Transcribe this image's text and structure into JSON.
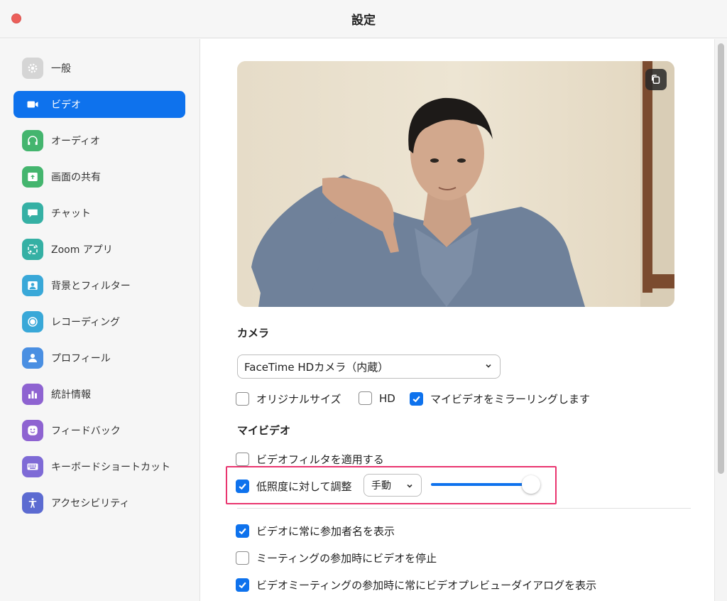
{
  "window": {
    "title": "設定"
  },
  "sidebar": {
    "items": [
      {
        "label": "一般",
        "icon": "gear-icon",
        "color": "#d5d5d5"
      },
      {
        "label": "ビデオ",
        "icon": "video-camera-icon",
        "color": "#0e72ed",
        "active": true
      },
      {
        "label": "オーディオ",
        "icon": "headphones-icon",
        "color": "#44b56e"
      },
      {
        "label": "画面の共有",
        "icon": "share-screen-icon",
        "color": "#44b56e"
      },
      {
        "label": "チャット",
        "icon": "chat-bubble-icon",
        "color": "#35b0a4"
      },
      {
        "label": "Zoom アプリ",
        "icon": "apps-icon",
        "color": "#35b0a4"
      },
      {
        "label": "背景とフィルター",
        "icon": "background-icon",
        "color": "#39a8d8"
      },
      {
        "label": "レコーディング",
        "icon": "record-icon",
        "color": "#39a8d8"
      },
      {
        "label": "プロフィール",
        "icon": "person-icon",
        "color": "#4a8fe2"
      },
      {
        "label": "統計情報",
        "icon": "bar-chart-icon",
        "color": "#8e63d1"
      },
      {
        "label": "フィードバック",
        "icon": "smiley-icon",
        "color": "#8e63d1"
      },
      {
        "label": "キーボードショートカット",
        "icon": "keyboard-icon",
        "color": "#7e6ad6"
      },
      {
        "label": "アクセシビリティ",
        "icon": "accessibility-icon",
        "color": "#5c6bd1"
      }
    ]
  },
  "camera": {
    "section_title": "カメラ",
    "selected_device": "FaceTime HDカメラ（内蔵）",
    "original_size_label": "オリジナルサイズ",
    "original_size_checked": false,
    "hd_label": "HD",
    "hd_checked": false,
    "mirror_label": "マイビデオをミラーリングします",
    "mirror_checked": true
  },
  "my_video": {
    "section_title": "マイビデオ",
    "filter_label": "ビデオフィルタを適用する",
    "filter_checked": false,
    "low_light_label": "低照度に対して調整",
    "low_light_checked": true,
    "low_light_mode": "手動",
    "low_light_level": 1.0
  },
  "options": [
    {
      "label": "ビデオに常に参加者名を表示",
      "checked": true
    },
    {
      "label": "ミーティングの参加時にビデオを停止",
      "checked": false
    },
    {
      "label": "ビデオミーティングの参加時に常にビデオプレビューダイアログを表示",
      "checked": true
    }
  ],
  "colors": {
    "accent": "#0e72ed",
    "highlight": "#e9356f"
  }
}
